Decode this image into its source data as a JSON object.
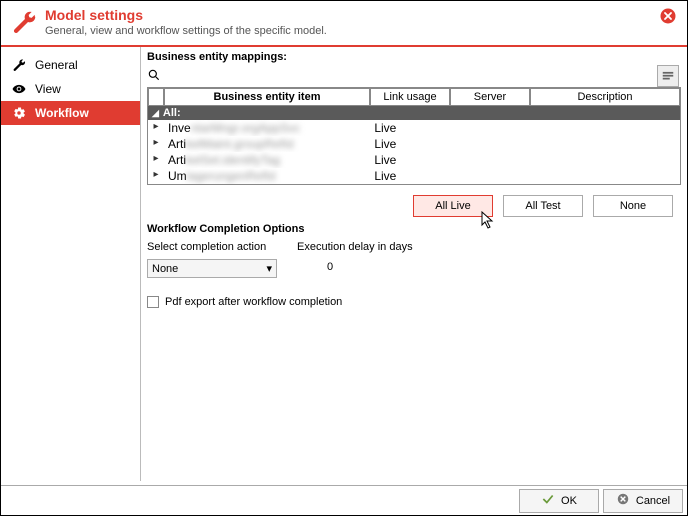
{
  "header": {
    "title": "Model settings",
    "subtitle": "General, view and workflow settings of the specific model."
  },
  "sidebar": {
    "items": [
      {
        "label": "General",
        "icon": "wrench-icon"
      },
      {
        "label": "View",
        "icon": "eye-icon"
      },
      {
        "label": "Workflow",
        "icon": "gear-icon"
      }
    ]
  },
  "main": {
    "section_title": "Business entity mappings:",
    "columns": {
      "c1": "Business entity item",
      "c2": "Link usage",
      "c3": "Server",
      "c4": "Description"
    },
    "group_label": "All:",
    "rows": [
      {
        "prefix": "Inve",
        "usage": "Live"
      },
      {
        "prefix": "Arti",
        "usage": "Live"
      },
      {
        "prefix": "Arti",
        "usage": "Live"
      },
      {
        "prefix": "Um",
        "usage": "Live"
      }
    ],
    "buttons": {
      "all_live": "All Live",
      "all_test": "All Test",
      "none": "None"
    },
    "wco": {
      "title": "Workflow Completion Options",
      "action_label": "Select completion action",
      "action_value": "None",
      "delay_label": "Execution delay in days",
      "delay_value": "0",
      "pdf_label": "Pdf export after workflow completion"
    }
  },
  "footer": {
    "ok": "OK",
    "cancel": "Cancel"
  }
}
